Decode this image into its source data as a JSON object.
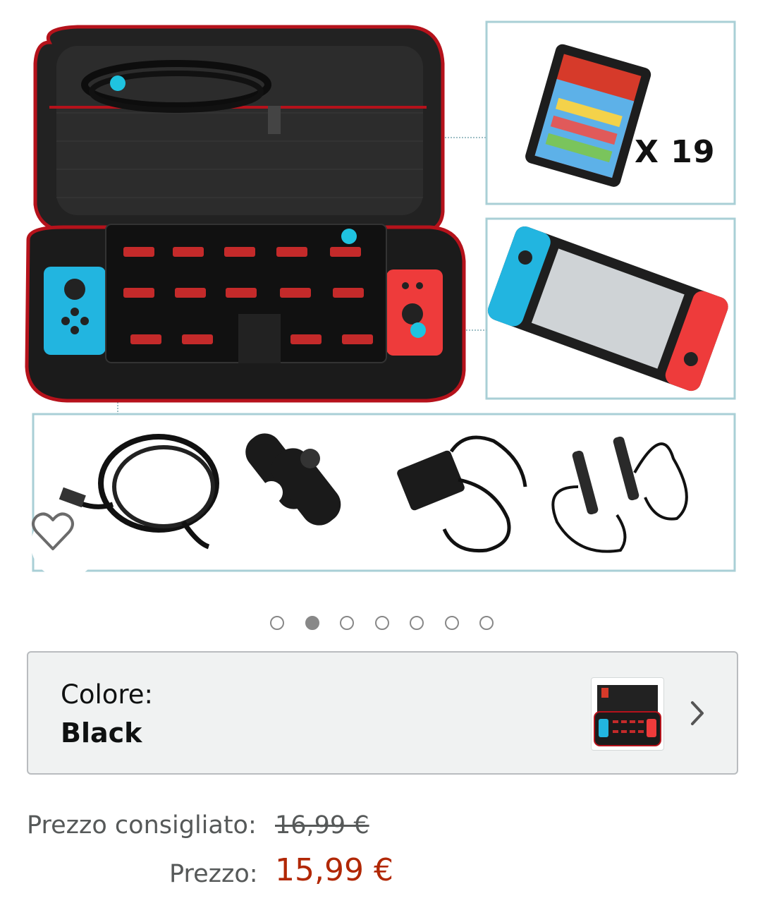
{
  "product_image": {
    "count_badge": "X 19",
    "favorite_icon": "heart-outline-icon"
  },
  "carousel": {
    "total": 7,
    "active_index": 1
  },
  "variant": {
    "label": "Colore:",
    "value": "Black",
    "chevron_icon": "chevron-right-icon"
  },
  "pricing": {
    "list_label": "Prezzo consigliato:",
    "list_price": "16,99 €",
    "price_label": "Prezzo:",
    "price": "15,99 €"
  },
  "colors": {
    "accent_teal": "#1fc3e0",
    "price_red": "#b12704",
    "joycon_blue": "#22b5e0",
    "joycon_red": "#ee3b3b"
  }
}
